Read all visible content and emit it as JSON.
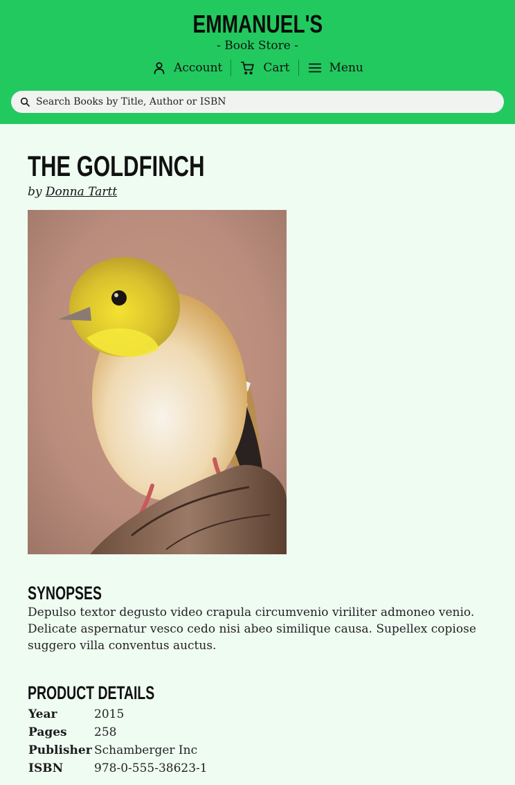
{
  "store": {
    "name": "EMMANUEL'S",
    "subtitle": "- Book Store -"
  },
  "nav": {
    "account": {
      "label": "Account",
      "icon": "user-icon"
    },
    "cart": {
      "label": "Cart",
      "icon": "cart-icon"
    },
    "menu": {
      "label": "Menu",
      "icon": "hamburger-icon"
    }
  },
  "search": {
    "placeholder": "Search Books by Title, Author or ISBN",
    "icon": "search-icon"
  },
  "book": {
    "title": "THE GOLDFINCH",
    "by": "by",
    "author": "Donna Tartt",
    "cover": "goldfinch-on-branch"
  },
  "synopsis": {
    "heading": "SYNOPSES",
    "text": "Depulso textor degusto video crapula circumvenio viriliter admoneo venio. Delicate aspernatur vesco cedo nisi abeo similique causa. Supellex copiose suggero villa conventus auctus."
  },
  "details": {
    "heading": "PRODUCT DETAILS",
    "rows": [
      {
        "label": "Year",
        "value": "2015"
      },
      {
        "label": "Pages",
        "value": "258"
      },
      {
        "label": "Publisher",
        "value": "Schamberger Inc"
      },
      {
        "label": "ISBN",
        "value": "978-0-555-38623-1"
      }
    ]
  },
  "colors": {
    "header": "#22c95f",
    "background": "#effcf2"
  }
}
